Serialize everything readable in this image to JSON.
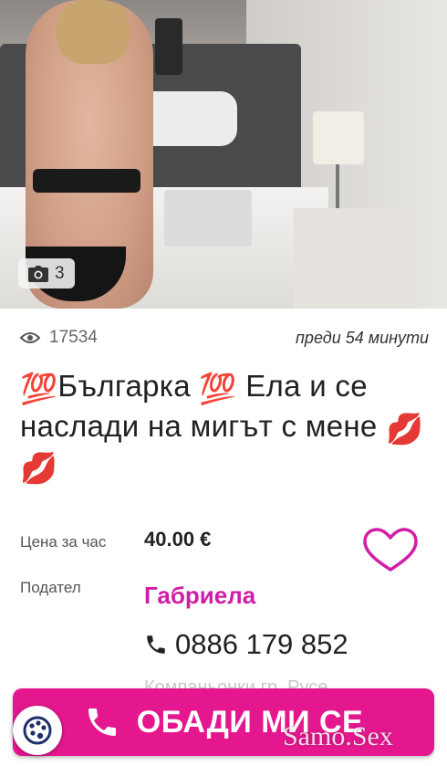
{
  "photo": {
    "count": "3",
    "camera_icon": "camera-icon"
  },
  "meta": {
    "views": "17534",
    "views_icon": "eye-icon",
    "time": "преди 54 минути"
  },
  "title": {
    "emoji1": "💯",
    "part1": "Българка ",
    "emoji2": "💯",
    "part2": " Ела и се наслади на мигът с мене ",
    "emoji3": "💋",
    "emoji4": "💋"
  },
  "details": {
    "price_label": "Цена за час",
    "price_value": "40.00 €",
    "poster_label": "Подател",
    "poster_name": "Габриела",
    "phone": "0886 179 852",
    "faded_text": "Компаньонки гр. Русе"
  },
  "call_button": {
    "label": "ОБАДИ МИ СЕ",
    "icon": "phone-icon"
  },
  "watermark": "Samo.Sex",
  "colors": {
    "accent": "#e5178f",
    "name": "#d01ea7"
  }
}
